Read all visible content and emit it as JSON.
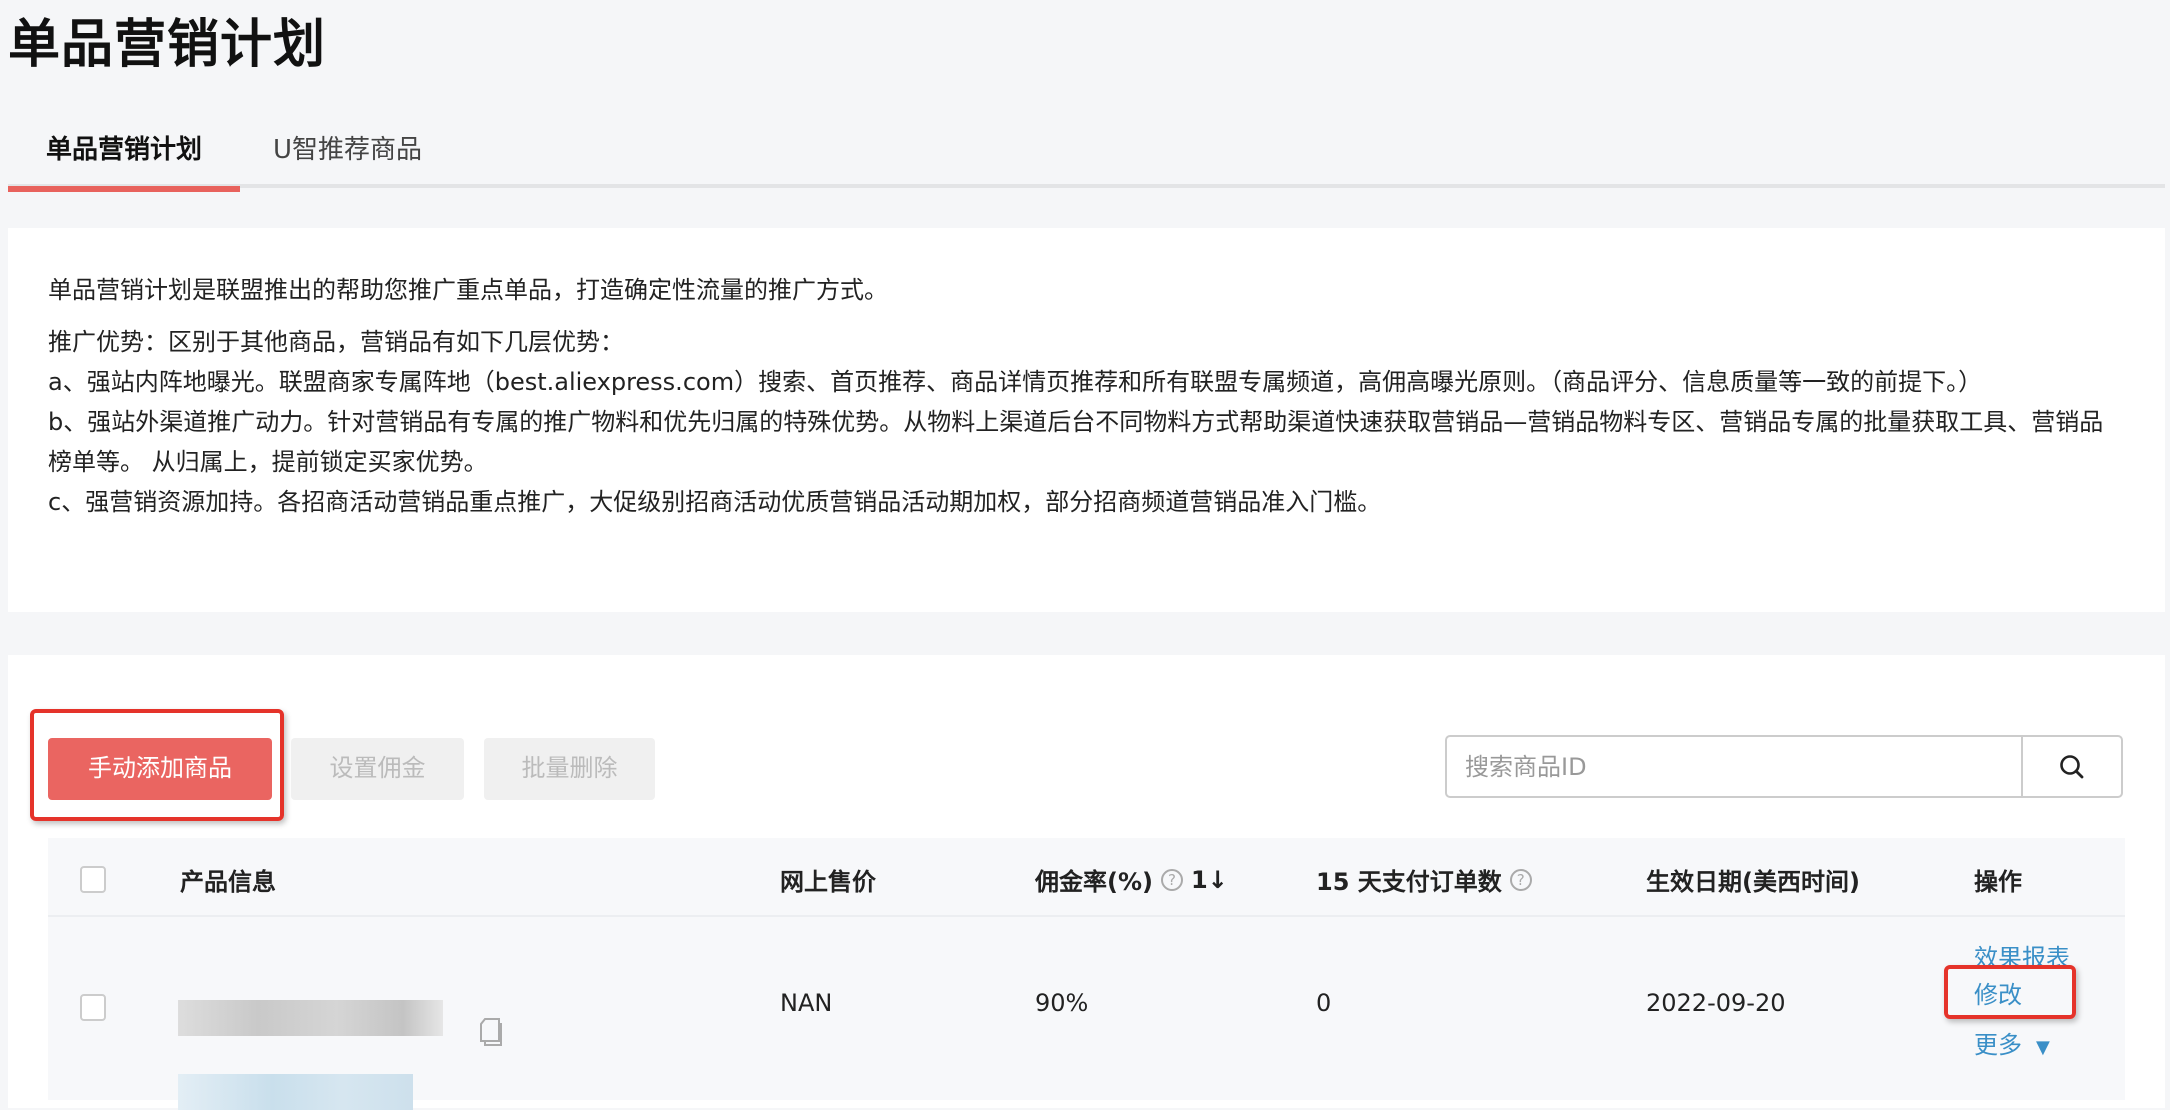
{
  "page_title": "单品营销计划",
  "tabs": [
    {
      "label": "单品营销计划",
      "active": true
    },
    {
      "label": "U智推荐商品",
      "active": false
    }
  ],
  "description": {
    "intro": "单品营销计划是联盟推出的帮助您推广重点单品，打造确定性流量的推广方式。",
    "advantages_heading": "推广优势：区别于其他商品，营销品有如下几层优势：",
    "a": "a、强站内阵地曝光。联盟商家专属阵地（best.aliexpress.com）搜索、首页推荐、商品详情页推荐和所有联盟专属频道，高佣高曝光原则。（商品评分、信息质量等一致的前提下。）",
    "b": "b、强站外渠道推广动力。针对营销品有专属的推广物料和优先归属的特殊优势。从物料上渠道后台不同物料方式帮助渠道快速获取营销品—营销品物料专区、营销品专属的批量获取工具、营销品榜单等。 从归属上，提前锁定买家优势。",
    "c": "c、强营销资源加持。各招商活动营销品重点推广，大促级别招商活动优质营销品活动期加权，部分招商频道营销品准入门槛。"
  },
  "toolbar": {
    "add_label": "手动添加商品",
    "set_commission_label": "设置佣金",
    "batch_delete_label": "批量删除",
    "search_placeholder": "搜索商品ID"
  },
  "table": {
    "headers": {
      "product": "产品信息",
      "price": "网上售价",
      "commission": "佣金率(%)",
      "orders": "15 天支付订单数",
      "date": "生效日期(美西时间)",
      "actions": "操作"
    },
    "sort_icon": "1↓",
    "rows": [
      {
        "price": "NAN",
        "commission": "90%",
        "orders": "0",
        "date": "2022-09-20",
        "actions": [
          "效果报表",
          "修改",
          "更多"
        ]
      }
    ]
  },
  "colors": {
    "accent": "#ea6561",
    "link": "#3a8fc7",
    "highlight": "#e5332a"
  }
}
